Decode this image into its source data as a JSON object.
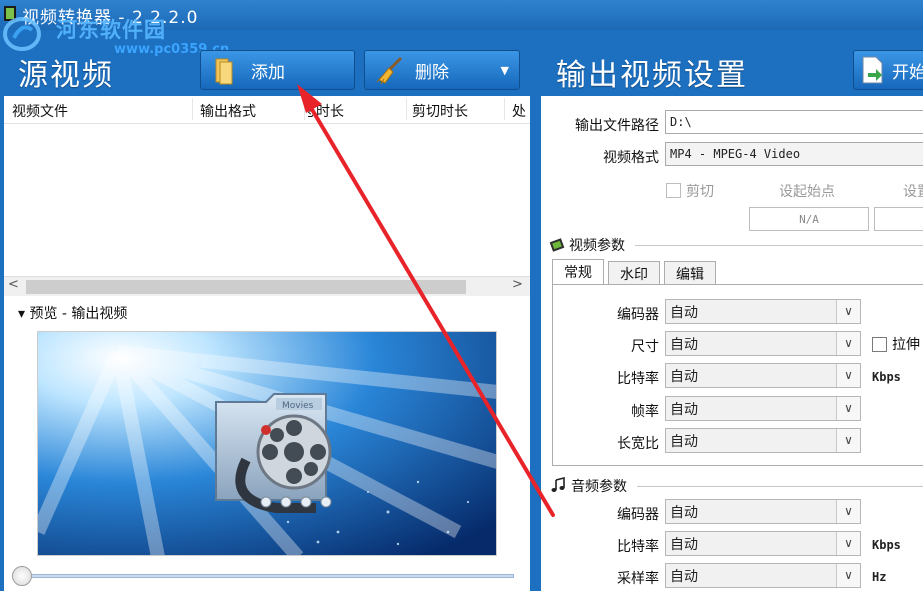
{
  "window": {
    "title": "视频转换器 - 2.2.2.0"
  },
  "watermark": {
    "text": "河东软件园",
    "url": "www.pc0359.cn"
  },
  "source": {
    "heading": "源视频",
    "add_label": "添加",
    "delete_label": "删除",
    "columns": [
      "视频文件",
      "输出格式",
      "总时长",
      "剪切时长",
      "处"
    ],
    "preview_label": "▾ 预览 - 输出视频",
    "preview_text": "Movies"
  },
  "output": {
    "heading": "输出视频设置",
    "start_label": "开始",
    "path_label": "输出文件路径",
    "path_value": "D:\\",
    "format_label": "视频格式",
    "format_value": "MP4 - MPEG-4 Video",
    "cut_label": "剪切",
    "set_start_label": "设起始点",
    "set_end_label": "设置",
    "start_point_value": "N/A",
    "video_params": {
      "title": "视频参数",
      "tabs": [
        "常规",
        "水印",
        "编辑"
      ],
      "rows": [
        {
          "label": "编码器",
          "value": "自动"
        },
        {
          "label": "尺寸",
          "value": "自动",
          "extra": "拉伸"
        },
        {
          "label": "比特率",
          "value": "自动",
          "unit": "Kbps"
        },
        {
          "label": "帧率",
          "value": "自动"
        },
        {
          "label": "长宽比",
          "value": "自动"
        }
      ]
    },
    "audio_params": {
      "title": "音频参数",
      "rows": [
        {
          "label": "编码器",
          "value": "自动"
        },
        {
          "label": "比特率",
          "value": "自动",
          "unit": "Kbps"
        },
        {
          "label": "采样率",
          "value": "自动",
          "unit": "Hz"
        }
      ]
    }
  },
  "colors": {
    "window_blue": "#1d6fbf",
    "button_blue": "#1668bb",
    "annotation_red": "#e8232a"
  }
}
